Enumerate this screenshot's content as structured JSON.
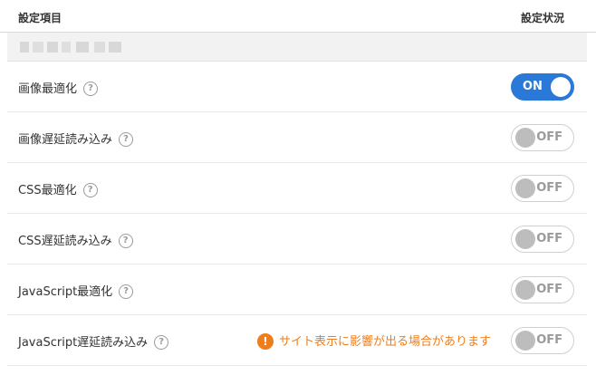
{
  "header": {
    "left_label": "設定項目",
    "right_label": "設定状況"
  },
  "rows": [
    {
      "label": "画像最適化",
      "toggle_state": "ON",
      "enabled": true
    },
    {
      "label": "画像遅延読み込み",
      "toggle_state": "OFF",
      "enabled": false
    },
    {
      "label": "CSS最適化",
      "toggle_state": "OFF",
      "enabled": false
    },
    {
      "label": "CSS遅延読み込み",
      "toggle_state": "OFF",
      "enabled": false
    },
    {
      "label": "JavaScript最適化",
      "toggle_state": "OFF",
      "enabled": false
    },
    {
      "label": "JavaScript遅延読み込み",
      "toggle_state": "OFF",
      "enabled": false
    }
  ],
  "warning": {
    "text": "サイト表示に影響が出る場合があります",
    "icon": "exclamation-icon",
    "color": "#ef7d1a"
  },
  "help_icon": {
    "glyph": "?",
    "icon": "question-circle-icon"
  },
  "colors": {
    "toggle_on": "#2a78d8",
    "toggle_off_knob": "#bdbdbd",
    "section_bar": "#f2f2f2"
  }
}
